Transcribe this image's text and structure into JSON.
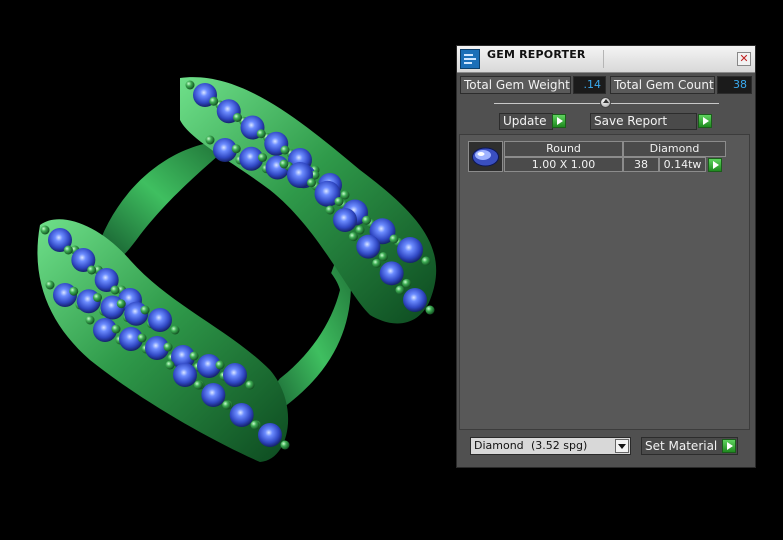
{
  "app": {
    "title": "GEM REPORTER"
  },
  "stats": {
    "total_weight_label": "Total Gem Weight",
    "total_weight_value": ".14",
    "total_count_label": "Total Gem Count",
    "total_count_value": "38"
  },
  "actions": {
    "update_label": "Update",
    "save_report_label": "Save Report"
  },
  "gem_rows": [
    {
      "icon": "round-gem-icon",
      "shape": "Round",
      "size": "1.00 X 1.00",
      "material": "Diamond",
      "count": "38",
      "weight": "0.14tw"
    }
  ],
  "material_select": {
    "name": "Diamond",
    "spg": "(3.52 spg)"
  },
  "set_material_label": "Set Material",
  "colors": {
    "panel_bg": "#505050",
    "value_text": "#3aaaf0",
    "play_green": "#2fae2f",
    "model_green": "#2f9a4a",
    "gem_blue": "#3a5fd6"
  }
}
